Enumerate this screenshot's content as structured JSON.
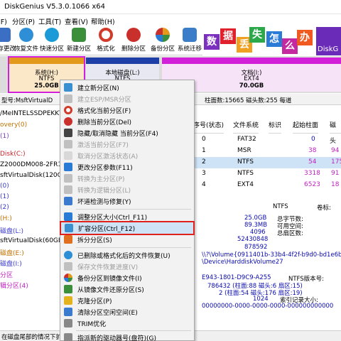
{
  "window": {
    "title": "DiskGenius V5.3.0.1066 x64"
  },
  "menu": [
    "文件(F)",
    "分区(P)",
    "工具(T)",
    "查看(V)",
    "帮助(H)"
  ],
  "toolbar": [
    {
      "label": "保存更改",
      "icon": "save-icon",
      "color": "#3a6fc4"
    },
    {
      "label": "恢复文件",
      "icon": "restore-files-icon",
      "color": "#2f8fd6"
    },
    {
      "label": "快速分区",
      "icon": "quick-partition-icon",
      "color": "#1a9ad6"
    },
    {
      "label": "新建分区",
      "icon": "new-partition-icon",
      "color": "#3b8f3b"
    },
    {
      "label": "格式化",
      "icon": "format-icon",
      "color": "#d23a2a"
    },
    {
      "label": "删除分区",
      "icon": "delete-partition-icon",
      "color": "#c9302c"
    },
    {
      "label": "备份分区",
      "icon": "backup-partition-icon",
      "color": "#e39a1c"
    },
    {
      "label": "系统迁移",
      "icon": "system-migrate-icon",
      "color": "#3c7dc9"
    }
  ],
  "banner": {
    "chars": [
      {
        "ch": "数",
        "color": "#7b2fbf"
      },
      {
        "ch": "据",
        "color": "#e0202a"
      },
      {
        "ch": "丢",
        "color": "#f0a020"
      },
      {
        "ch": "失",
        "color": "#2aa84a"
      },
      {
        "ch": "怎",
        "color": "#2a7bd6"
      },
      {
        "ch": "么",
        "color": "#c42aa0"
      },
      {
        "ch": "办",
        "color": "#f05a20"
      }
    ],
    "brand": "DiskG"
  },
  "diskmap": {
    "partitions": [
      {
        "name": "系统(H:)",
        "fs": "NTFS",
        "size": "25.0GB",
        "color": "#e39a1c",
        "selected": true
      },
      {
        "name": "本地磁盘(L:)",
        "fs": "NTFS",
        "size": "",
        "color": "#1f3fa8",
        "selected": false
      },
      {
        "name": "文档(I:)",
        "fs": "EXT4",
        "size": "70.0GB",
        "color": "#d21fd8",
        "selected": false
      }
    ]
  },
  "diskinfo": {
    "left": "型号:MsftVirtualD",
    "right": "柱面数:15665 磁头数:255 每道"
  },
  "tree": [
    {
      "text": "/MeINTELSSDPEKKV",
      "color": "#000000"
    },
    {
      "text": "overy(0)",
      "color": "#c07000"
    },
    {
      "text": "(1)",
      "color": "#7a3fbf"
    },
    {
      "text": "Disk(C:)",
      "color": "#d0202a"
    },
    {
      "text": "Z2000DM008-2FR102",
      "color": "#000000"
    },
    {
      "text": "sftVirtualDisk(120GB",
      "color": "#000000"
    },
    {
      "text": "(0)",
      "color": "#3a3ad0"
    },
    {
      "text": "(1)",
      "color": "#3a3ad0"
    },
    {
      "text": "(2)",
      "color": "#3a3ad0"
    },
    {
      "text": "(H:)",
      "color": "#c07000"
    },
    {
      "text": "磁盘(L:)",
      "color": "#3a3ad0"
    },
    {
      "text": "sftVirtualDisk(60GB",
      "color": "#000000"
    },
    {
      "text": "磁盘(E:)",
      "color": "#c07000"
    },
    {
      "text": "磁盘(I:)",
      "color": "#3a3ad0"
    },
    {
      "text": "分区",
      "color": "#c020c0"
    },
    {
      "text": "辑分区(4)",
      "color": "#c020c0"
    }
  ],
  "table": {
    "headers": [
      "序号(状态)",
      "文件系统",
      "标识",
      "起始柱面",
      "磁头"
    ],
    "rows": [
      {
        "num": "0",
        "fs": "FAT32",
        "id": "",
        "cyl": "0",
        "head": "",
        "sel": false
      },
      {
        "num": "1",
        "fs": "MSR",
        "id": "",
        "cyl": "38",
        "head": "94",
        "sel": false
      },
      {
        "num": "2",
        "fs": "NTFS",
        "id": "",
        "cyl": "54",
        "head": "175",
        "sel": true
      },
      {
        "num": "3",
        "fs": "NTFS",
        "id": "",
        "cyl": "3318",
        "head": "91",
        "sel": false
      },
      {
        "num": "4",
        "fs": "EXT4",
        "id": "",
        "cyl": "6523",
        "head": "18",
        "sel": false
      }
    ]
  },
  "details": {
    "fs_label": "NTFS",
    "vol_label": "卷标:",
    "values": [
      "25.0GB",
      "89.3MB",
      "4096",
      "52430848",
      "878592"
    ],
    "labels": [
      "总字节数:",
      "可用空间:",
      "总扇区数:",
      "",
      ""
    ],
    "path1": "\\\\?\\Volume{0911401b-33b4-4f2f-b9d0-bd1e6b",
    "path2": "\\Device\\HarddiskVolume27",
    "serial": "E943-1801-D9C9-A255",
    "ver_label": "NTFS版本号:",
    "mft1": "786432 (柱面:88 磁头:6 扇区:15)",
    "mft2": "2 (柱面:54 磁头:176 扇区:19)",
    "idx": "1024",
    "idx_label": "索引记录大小:",
    "guid": "00000000-0000-0000-0000-000000000000"
  },
  "statusbar": {
    "text": "在磁盘尾部的情况下扩大分区"
  },
  "ctxmenu": [
    {
      "label": "建立新分区(N)",
      "icon": "new-partition-icon",
      "disabled": false,
      "color": "#3a8fd0"
    },
    {
      "label": "建立ESP/MSR分区",
      "icon": "esp-msr-icon",
      "disabled": true,
      "color": "#c0c0c0"
    },
    {
      "label": "格式化当前分区(F)",
      "icon": "format-icon",
      "disabled": false,
      "color": "#d23a2a"
    },
    {
      "label": "删除当前分区(Del)",
      "icon": "delete-icon",
      "disabled": false,
      "color": "#c9302c"
    },
    {
      "label": "隐藏/取消隐藏 当前分区(F4)",
      "icon": "hide-icon",
      "disabled": false,
      "color": "#444444"
    },
    {
      "label": "激活当前分区(F7)",
      "icon": "activate-icon",
      "disabled": true,
      "color": "#c0c0c0"
    },
    {
      "label": "取消分区激活状态(A)",
      "icon": "deactivate-icon",
      "disabled": true,
      "color": "#c0c0c0"
    },
    {
      "label": "更改分区参数(F11)",
      "icon": "params-icon",
      "disabled": false,
      "color": "#2a7bd6"
    },
    {
      "label": "转换为主分区(P)",
      "icon": "to-primary-icon",
      "disabled": true,
      "color": "#c0c0c0"
    },
    {
      "label": "转换为逻辑分区(L)",
      "icon": "to-logical-icon",
      "disabled": true,
      "color": "#c0c0c0"
    },
    {
      "label": "坏道检测与修复(Y)",
      "icon": "bad-sector-icon",
      "disabled": false,
      "color": "#3a7bd0"
    },
    {
      "sep": true
    },
    {
      "label": "调整分区大小(Ctrl_F11)",
      "icon": "resize-icon",
      "disabled": false,
      "color": "#2a7bd6"
    },
    {
      "label": "扩容分区(Ctrl_F12)",
      "icon": "extend-icon",
      "disabled": false,
      "color": "#3a8fd0",
      "sel": true
    },
    {
      "label": "拆分分区(S)",
      "icon": "split-icon",
      "disabled": false,
      "color": "#e07020"
    },
    {
      "sep": true
    },
    {
      "label": "已删除或格式化后的文件恢复(U)",
      "icon": "recover-icon",
      "disabled": false,
      "color": "#2f8fd6"
    },
    {
      "label": "保存文件恢复进度(V)",
      "icon": "save-progress-icon",
      "disabled": true,
      "color": "#c0c0c0"
    },
    {
      "label": "备份分区到镜像文件(I)",
      "icon": "backup-image-icon",
      "disabled": false,
      "color": "#e39a1c"
    },
    {
      "label": "从镜像文件还原分区(S)",
      "icon": "restore-image-icon",
      "disabled": false,
      "color": "#3b8f3b"
    },
    {
      "label": "克隆分区(P)",
      "icon": "clone-icon",
      "disabled": false,
      "color": "#e3b21c"
    },
    {
      "label": "清除分区空闲空间(E)",
      "icon": "wipe-free-icon",
      "disabled": false,
      "color": "#3a7bd0"
    },
    {
      "label": "TRIM优化",
      "icon": "trim-icon",
      "disabled": false,
      "color": "#888888"
    },
    {
      "sep": true
    },
    {
      "label": "指派新的驱动器号(盘符)(G)",
      "icon": "drive-letter-icon",
      "disabled": false,
      "color": "#888888"
    }
  ]
}
